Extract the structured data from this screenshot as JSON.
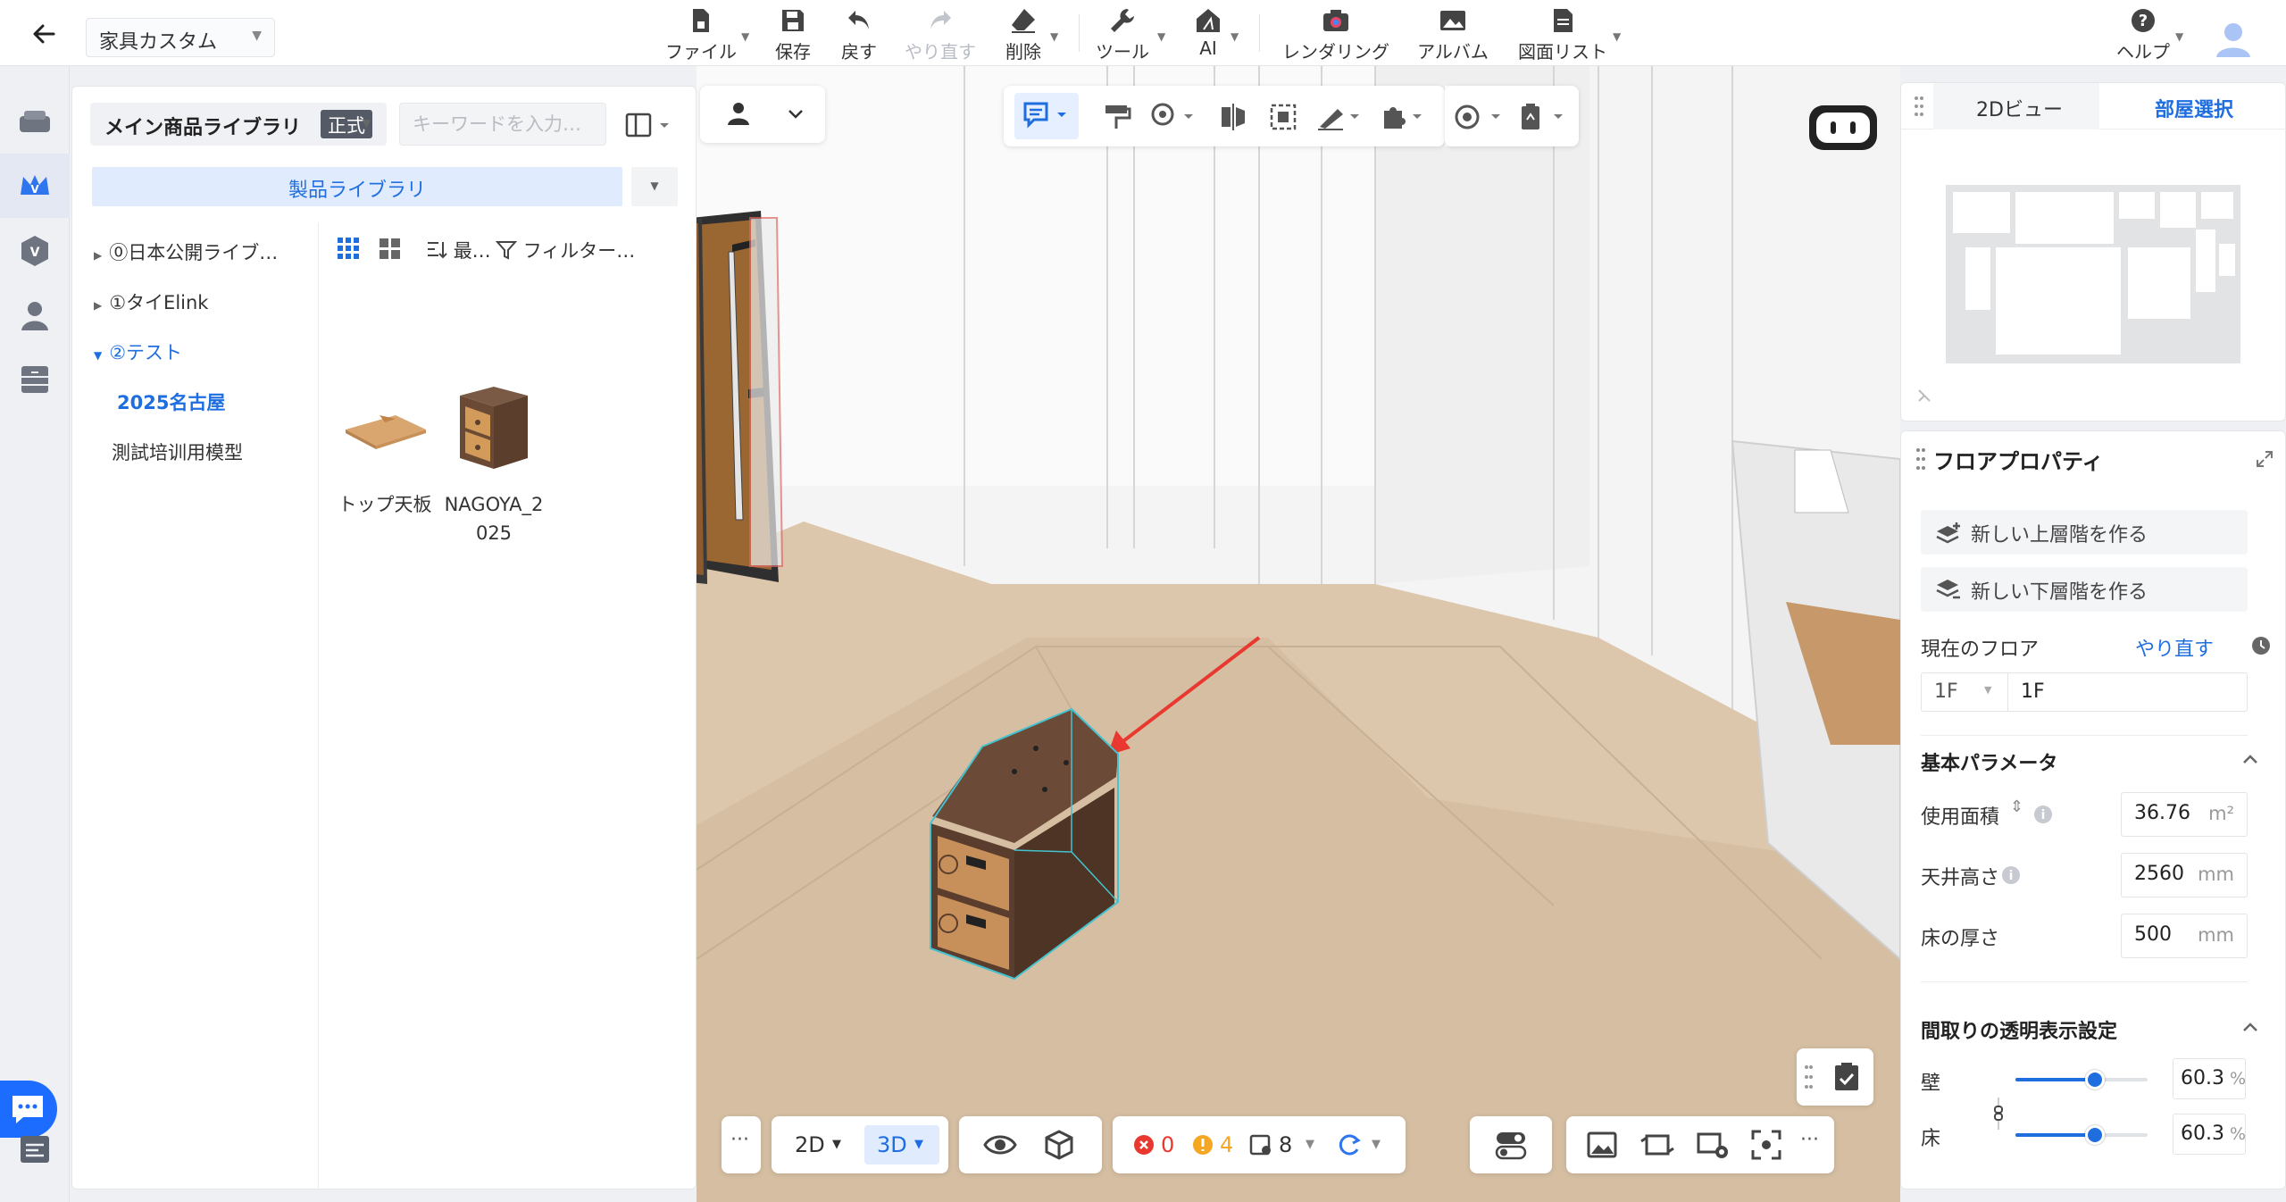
{
  "topbar": {
    "project_name": "家具カスタム",
    "buttons": {
      "file": "ファイル",
      "save": "保存",
      "undo": "戻す",
      "redo": "やり直す",
      "delete": "削除",
      "tools": "ツール",
      "ai": "AI",
      "rendering": "レンダリング",
      "album": "アルバム",
      "drawing_list": "図面リスト",
      "help": "ヘルプ"
    }
  },
  "library": {
    "title": "メイン商品ライブラリ",
    "badge": "正式",
    "search_placeholder": "キーワードを入力…",
    "product_library_button": "製品ライブラリ",
    "tree": [
      {
        "label": "⓪日本公開ライブ…",
        "expanded": false
      },
      {
        "label": "①タイElink",
        "expanded": false
      },
      {
        "label": "②テスト",
        "expanded": true
      },
      {
        "label": "2025名古屋",
        "selected": true
      },
      {
        "label": "測試培训用模型"
      }
    ],
    "sort_label": "最…",
    "filter_label": "フィルター…",
    "products": [
      {
        "name": "トップ天板"
      },
      {
        "name": "NAGOYA_2025"
      }
    ]
  },
  "viewport": {
    "view_2d": "2D",
    "view_3d": "3D",
    "errors": "0",
    "warnings": "4",
    "items": "8"
  },
  "minimap": {
    "tab_2d": "2Dビュー",
    "tab_room": "部屋選択"
  },
  "properties": {
    "title": "フロアプロパティ",
    "new_upper_floor": "新しい上層階を作る",
    "new_lower_floor": "新しい下層階を作る",
    "current_floor_label": "現在のフロア",
    "redo_link": "やり直す",
    "floor_select": "1F",
    "floor_name": "1F",
    "basic_params_title": "基本パラメータ",
    "area_label": "使用面積",
    "area_value": "36.76",
    "area_unit": "m²",
    "ceiling_label": "天井高さ",
    "ceiling_value": "2560",
    "ceiling_unit": "mm",
    "floor_thickness_label": "床の厚さ",
    "floor_thickness_value": "500",
    "floor_thickness_unit": "mm",
    "transparency_title": "間取りの透明表示設定",
    "wall_label": "壁",
    "wall_value": "60.3",
    "floor_label": "床",
    "floor_value": "60.3",
    "pct_unit": "%"
  },
  "colors": {
    "accent": "#1f6ee0",
    "accent_bg": "#e0ecfd",
    "error": "#e8382f",
    "warning": "#f5a623",
    "floor": "#d9c3a9",
    "door_wood": "#8a5a2e"
  }
}
